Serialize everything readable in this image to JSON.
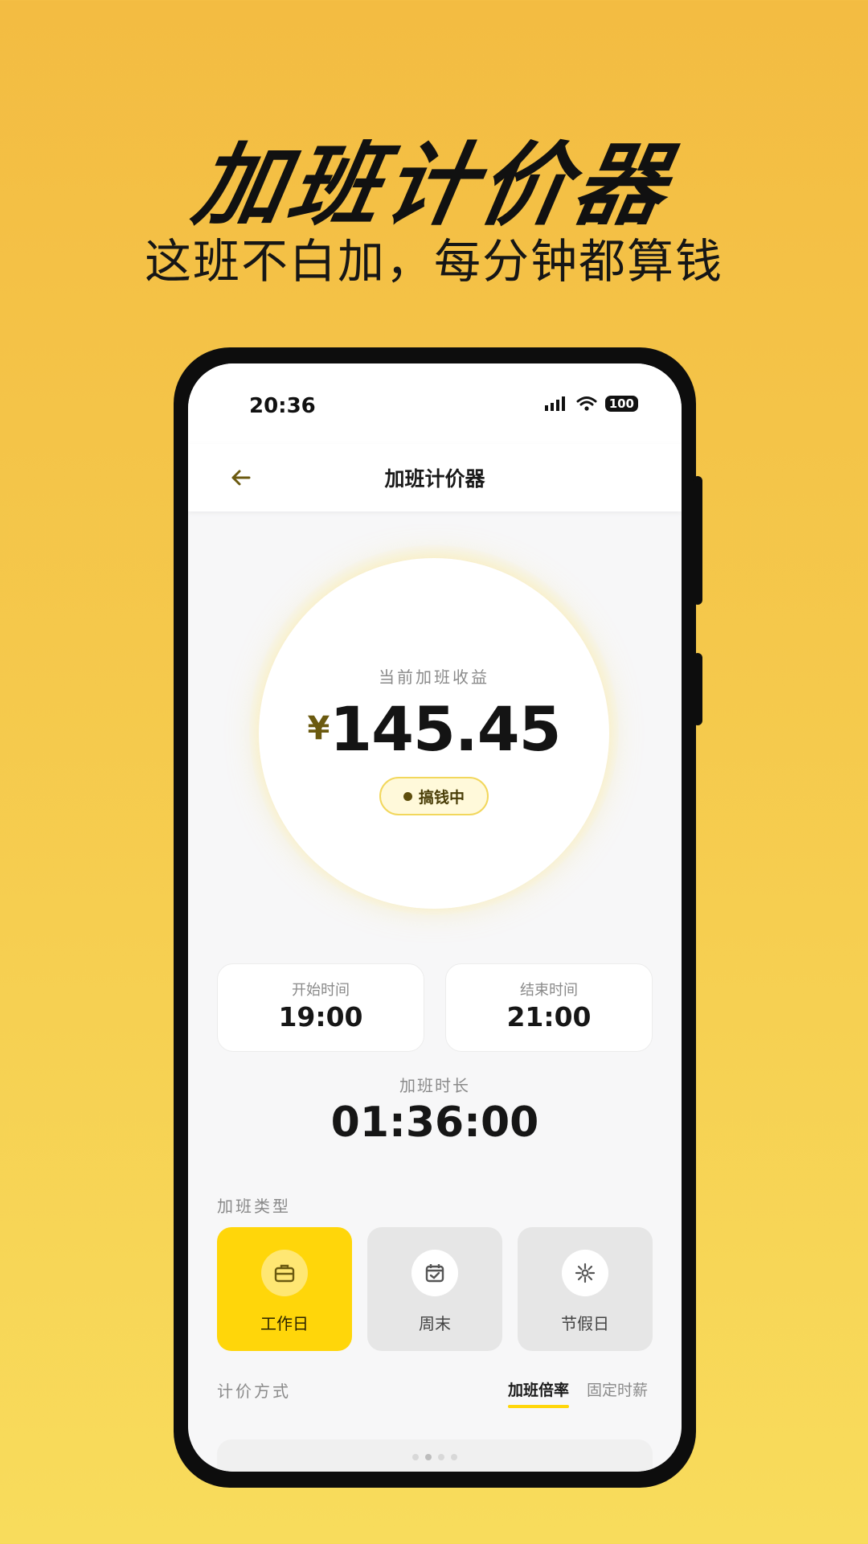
{
  "promo": {
    "title": "加班计价器",
    "subtitle": "这班不白加，每分钟都算钱"
  },
  "status_bar": {
    "time": "20:36",
    "battery": "100"
  },
  "nav": {
    "title": "加班计价器",
    "back_icon": "arrow-left-icon"
  },
  "earnings": {
    "label": "当前加班收益",
    "currency": "¥",
    "amount": "145.45",
    "status": "搞钱中"
  },
  "times": {
    "start_label": "开始时间",
    "start_value": "19:00",
    "end_label": "结束时间",
    "end_value": "21:00"
  },
  "duration": {
    "label": "加班时长",
    "value": "01:36:00"
  },
  "overtime_type": {
    "label": "加班类型",
    "options": [
      {
        "label": "工作日",
        "icon": "briefcase-icon",
        "selected": true
      },
      {
        "label": "周末",
        "icon": "calendar-check-icon",
        "selected": false
      },
      {
        "label": "节假日",
        "icon": "sparkle-icon",
        "selected": false
      }
    ]
  },
  "pricing": {
    "label": "计价方式",
    "tabs": [
      {
        "label": "加班倍率",
        "active": true
      },
      {
        "label": "固定时薪",
        "active": false
      }
    ]
  },
  "colors": {
    "accent": "#ffd60a",
    "background_top": "#f3bc42",
    "background_bottom": "#f8dc5c"
  }
}
